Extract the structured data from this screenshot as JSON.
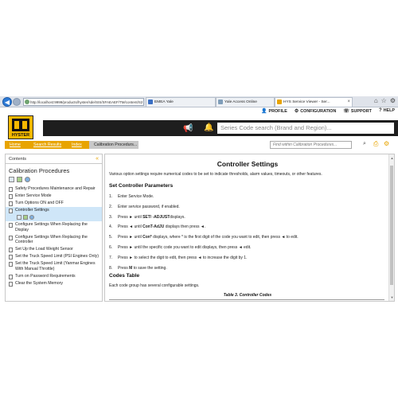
{
  "browser": {
    "address": "http://localhost:9999/products/hyster/sde/SIS/SFAEAEF/TM/content/S2",
    "tabs": [
      {
        "label": "EMEA Yale",
        "color": "#3a6fc4"
      },
      {
        "label": "Yale Access Online",
        "color": "#7f9db9"
      },
      {
        "label": "HYS Service Viewer - Ser...",
        "color": "#e8a400"
      }
    ],
    "icons": [
      "home-icon",
      "star-icon",
      "gear-icon"
    ]
  },
  "header": {
    "nav": [
      {
        "icon": "user-icon",
        "label": "PROFILE"
      },
      {
        "icon": "configuration-icon",
        "label": "CONFIGURATION"
      },
      {
        "icon": "support-icon",
        "label": "SUPPORT"
      },
      {
        "icon": "help-icon",
        "label": "HELP"
      }
    ],
    "logo_text": "HYSTER",
    "search_placeholder": "Series Code search (Brand and Region)..."
  },
  "breadcrumb": {
    "items": [
      "Home",
      "Search Results",
      "Index",
      "Calibration Procedurs..."
    ],
    "find_placeholder": "Find within Calibration Procedures..."
  },
  "sidebar": {
    "header": "Contents",
    "title": "Calibration Procedures",
    "items": [
      "Safety Procedures Maintenance and Repair",
      "Enter Service Mode",
      "Turn Options ON and OFF",
      "Controller Settings",
      "Configure Settings When Replacing the Display",
      "Configure Settings When Replacing the Controller",
      "Set Up the Load Weight Sensor",
      "Set the Truck Speed Limit (PSI Engines Only)",
      "Set the Truck Speed Limit (Yanmar Engines With Manual Throttle)",
      "Turn on Password Requirements",
      "Clear the System Memory"
    ],
    "selected_index": 3
  },
  "content": {
    "title": "Controller Settings",
    "intro": "Various option settings require numerical codes to be set to indicate thresholds, alarm values, timeouts, or other features.",
    "section_heading": "Set Controller Parameters",
    "steps": [
      {
        "num": "1.",
        "pre": "Enter Service Mode.",
        "bold": "",
        "post": ""
      },
      {
        "num": "2.",
        "pre": "Enter service password, if enabled.",
        "bold": "",
        "post": ""
      },
      {
        "num": "3.",
        "pre": "Press ► until ",
        "bold": "SET/ -ADJUST",
        "post": "displays."
      },
      {
        "num": "4.",
        "pre": "Press ◄ until ",
        "bold": "ConT-AdJU",
        "post": " displays then press ◄."
      },
      {
        "num": "5.",
        "pre": "Press ► until ",
        "bold": "Con*",
        "post": " displays, where * is the first digit of the code you want to edit, then press ◄ to edit."
      },
      {
        "num": "6.",
        "pre": "Press ► until the specific code you want to edit displays, then press ◄ edit.",
        "bold": "",
        "post": ""
      },
      {
        "num": "7.",
        "pre": "Press ► to select the digit to edit, then press ◄ to increase the digit by 1.",
        "bold": "",
        "post": ""
      },
      {
        "num": "8.",
        "pre": "Press ",
        "bold": "M",
        "post": " to save the setting."
      }
    ],
    "codes_heading": "Codes Table",
    "codes_text": "Each code group has several configurable settings.",
    "table_caption": "Table 3. Controller Codes"
  }
}
